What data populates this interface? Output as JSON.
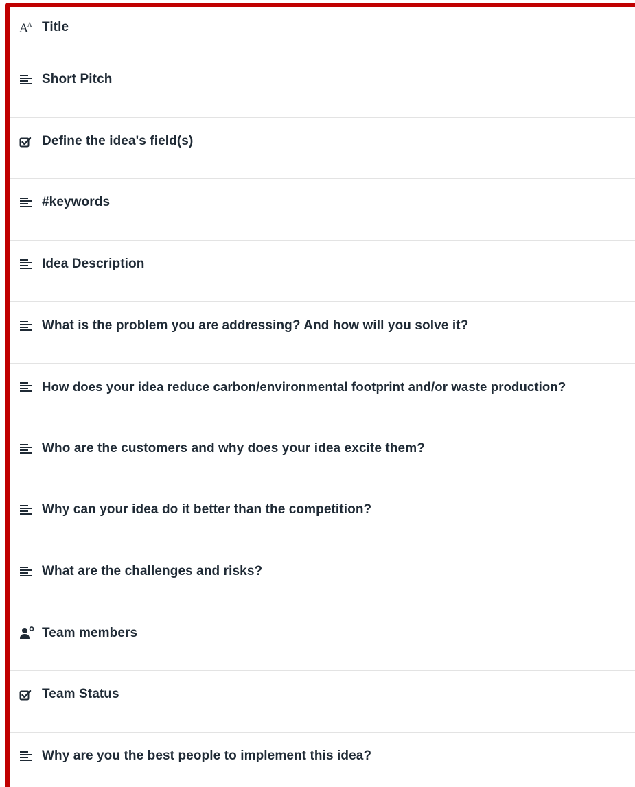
{
  "fields": [
    {
      "label": "Title",
      "icon": "text-size-icon"
    },
    {
      "label": "Short Pitch",
      "icon": "paragraph-icon"
    },
    {
      "label": "Define the idea's field(s)",
      "icon": "checkbox-icon"
    },
    {
      "label": "#keywords",
      "icon": "paragraph-icon"
    },
    {
      "label": "Idea Description",
      "icon": "paragraph-icon"
    },
    {
      "label": "What is the problem you are addressing? And how will you solve it?",
      "icon": "paragraph-icon"
    },
    {
      "label": "How does your idea reduce carbon/environmental footprint and/or waste production?",
      "icon": "paragraph-icon"
    },
    {
      "label": "Who are the customers and why does your idea excite them?",
      "icon": "paragraph-icon"
    },
    {
      "label": "Why can your idea do it better than the competition?",
      "icon": "paragraph-icon"
    },
    {
      "label": "What are the challenges and risks?",
      "icon": "paragraph-icon"
    },
    {
      "label": "Team members",
      "icon": "user-icon"
    },
    {
      "label": "Team Status",
      "icon": "checkbox-icon"
    },
    {
      "label": "Why are you the best people to implement this idea?",
      "icon": "paragraph-icon"
    }
  ],
  "colors": {
    "highlight_border": "#c00000",
    "text": "#1f2a35",
    "divider": "#e3e3e3"
  }
}
